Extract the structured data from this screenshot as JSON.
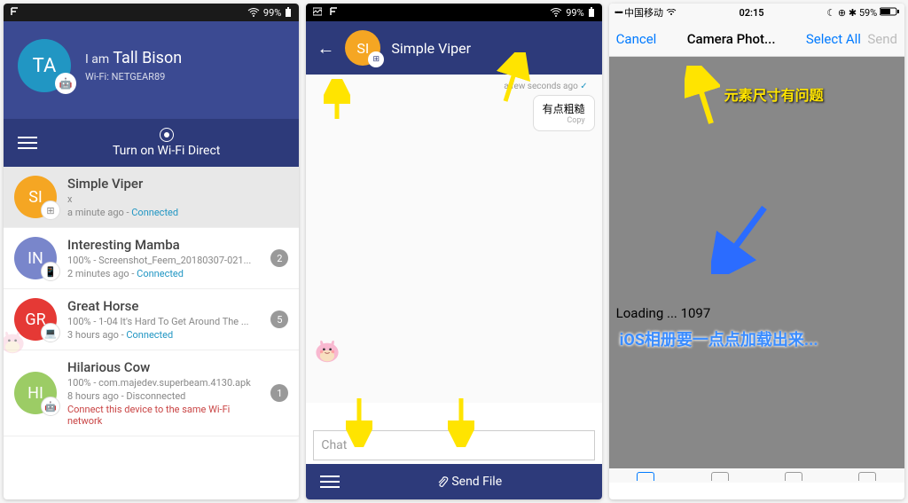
{
  "phone1": {
    "status": {
      "battery": "99%"
    },
    "profile": {
      "prefix": "I am",
      "name": "Tall Bison",
      "avatar": "TA",
      "wifi": "Wi-Fi: NETGEAR89"
    },
    "wifi_direct_label": "Turn on Wi-Fi Direct",
    "contacts": [
      {
        "initials": "SI",
        "color": "#f5a623",
        "name": "Simple Viper",
        "line1": "x",
        "time": "a minute ago",
        "status": "Connected",
        "status_class": "connected",
        "badge": "",
        "icon": "⊞"
      },
      {
        "initials": "IN",
        "color": "#7986cb",
        "name": "Interesting Mamba",
        "line1": "100% - Screenshot_Feem_20180307-021...",
        "time": "2 minutes ago",
        "status": "Connected",
        "status_class": "connected",
        "badge": "2",
        "icon": "📱"
      },
      {
        "initials": "GR",
        "color": "#e53935",
        "name": "Great Horse",
        "line1": "100% - 1-04 It's Hard To Get Around The ...",
        "time": "3 hours ago",
        "status": "Connected",
        "status_class": "connected",
        "badge": "5",
        "icon": "💻"
      },
      {
        "initials": "HI",
        "color": "#9ccc65",
        "name": "Hilarious Cow",
        "line1": "100% - com.majedev.superbeam.4130.apk",
        "time": "8 hours ago",
        "status": "Disconnected",
        "status_class": "",
        "badge": "1",
        "icon": "🤖",
        "warning": "Connect this device to the same Wi-Fi network"
      }
    ]
  },
  "phone2": {
    "status": {
      "battery": "99%"
    },
    "chat": {
      "avatar": "SI",
      "title": "Simple Viper",
      "timestamp": "a few seconds ago",
      "message": "有点粗糙",
      "message_sub": "Copy",
      "input_placeholder": "Chat"
    },
    "send_file_label": "Send File"
  },
  "phone3": {
    "status": {
      "carrier": "中国移动",
      "time": "02:15",
      "battery": "59%"
    },
    "nav": {
      "cancel": "Cancel",
      "title": "Camera Phot...",
      "select_all": "Select All",
      "send": "Send"
    },
    "annotation1": "元素尺寸有问题",
    "loading": "Loading ... 1097",
    "annotation2": "iOS相册要一点点加载出来..."
  }
}
